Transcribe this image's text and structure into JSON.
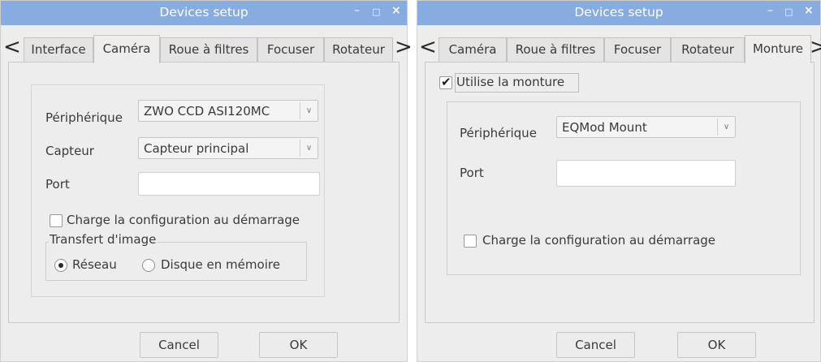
{
  "left_window": {
    "title": "Devices setup",
    "controls": {
      "minimize": "–",
      "maximize": "□",
      "close": "×"
    },
    "tabs": [
      {
        "label": "Interface"
      },
      {
        "label": "Caméra",
        "active": true
      },
      {
        "label": "Roue à filtres"
      },
      {
        "label": "Focuser"
      },
      {
        "label": "Rotateur"
      }
    ],
    "scroll_left": "<",
    "scroll_right": ">",
    "device_label": "Périphérique",
    "device_value": "ZWO CCD ASI120MC",
    "sensor_label": "Capteur",
    "sensor_value": "Capteur principal",
    "port_label": "Port",
    "port_value": "",
    "load_config_label": "Charge la configuration au démarrage",
    "load_config_checked": false,
    "transfer_group_label": "Transfert d'image",
    "radio_network_label": "Réseau",
    "radio_network_selected": true,
    "radio_disk_label": "Disque en mémoire",
    "cancel_label": "Cancel",
    "ok_label": "OK"
  },
  "right_window": {
    "title": "Devices setup",
    "controls": {
      "minimize": "–",
      "maximize": "□",
      "close": "×"
    },
    "tabs": [
      {
        "label": "Caméra"
      },
      {
        "label": "Roue à filtres"
      },
      {
        "label": "Focuser"
      },
      {
        "label": "Rotateur"
      },
      {
        "label": "Monture",
        "active": true
      }
    ],
    "scroll_left": "<",
    "scroll_right": ">",
    "use_mount_label": "Utilise la monture",
    "use_mount_checked": true,
    "device_label": "Périphérique",
    "device_value": "EQMod Mount",
    "port_label": "Port",
    "port_value": "",
    "load_config_label": "Charge la configuration au démarrage",
    "load_config_checked": false,
    "cancel_label": "Cancel",
    "ok_label": "OK"
  },
  "colors": {
    "titlebar": "#87ace0",
    "window_bg": "#ededed",
    "border": "#c8c8c8"
  }
}
